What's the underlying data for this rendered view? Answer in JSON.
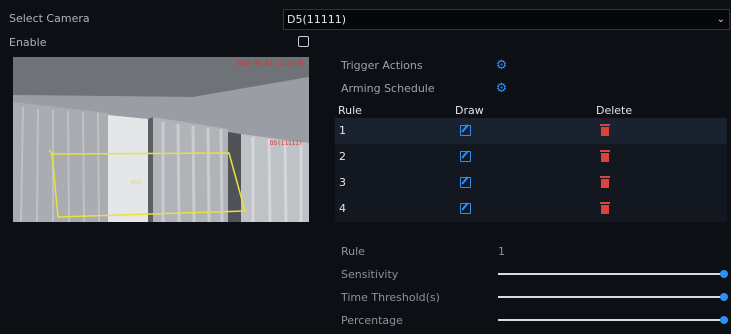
{
  "form": {
    "camera_label": "Select Camera",
    "camera_value": "D5(11111)",
    "enable_label": "Enable",
    "enable_checked": false
  },
  "preview": {
    "timestamp": "2020-08-03 13:20:45",
    "tag": "D5(11111)",
    "zone_label": "#01"
  },
  "options": {
    "trigger_actions": "Trigger Actions",
    "arming_schedule": "Arming Schedule",
    "gear_icon": "gear-icon"
  },
  "rules_table": {
    "headers": {
      "rule": "Rule",
      "draw": "Draw",
      "delete": "Delete"
    },
    "rows": [
      {
        "rule": "1"
      },
      {
        "rule": "2"
      },
      {
        "rule": "3"
      },
      {
        "rule": "4"
      }
    ],
    "selected_row": "1",
    "accent_color": "#2f8ff5",
    "delete_color": "#e0413a"
  },
  "params": {
    "rule_label": "Rule",
    "rule_value": "1",
    "sensitivity_label": "Sensitivity",
    "sensitivity_level": 1.0,
    "time_threshold_label": "Time Threshold(s)",
    "time_threshold_level": 1.0,
    "percentage_label": "Percentage",
    "percentage_level": 1.0
  }
}
